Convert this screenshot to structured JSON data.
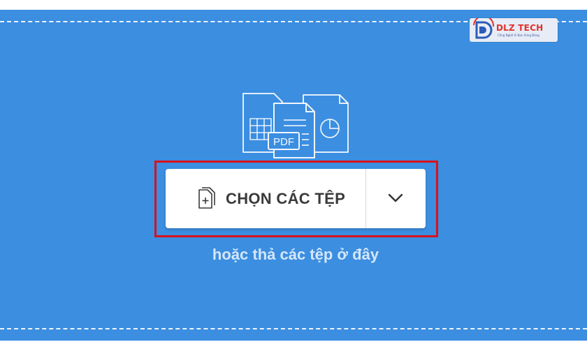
{
  "brand": {
    "name": "DLZ TECH",
    "tagline": "Công Nghệ Vì Bạn Xứng Đáng",
    "logo_icon": "dlz-logo-icon"
  },
  "illustration": {
    "icon": "file-types-icon",
    "pdf_label": "PDF"
  },
  "upload": {
    "choose_files_label": "CHỌN CÁC TỆP",
    "choose_files_icon": "file-add-icon",
    "dropdown_icon": "chevron-down-icon",
    "drop_hint": "hoặc thả các tệp ở đây"
  },
  "colors": {
    "background": "#3b8ee0",
    "highlight": "#d9111d",
    "button": "#ffffff",
    "button_text": "#3a3a3a"
  }
}
